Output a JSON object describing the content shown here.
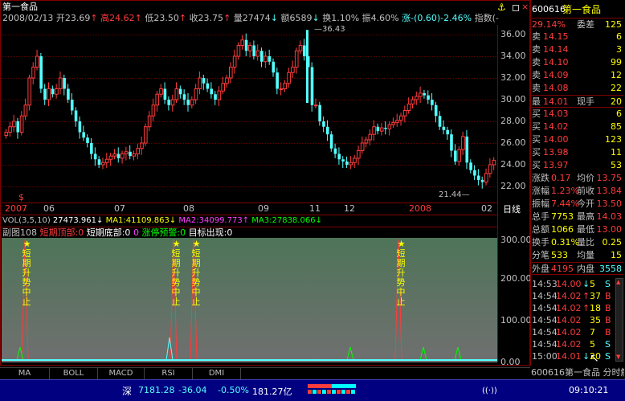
{
  "main_chart": {
    "title": "第一食品",
    "info": {
      "date": "2008/02/13",
      "open": "开23.69",
      "high": "高24.62",
      "low": "低23.50",
      "close": "收23.75",
      "volume": "量27474",
      "amount": "额6589",
      "turnover": "换1.10%",
      "amplitude": "振4.60%",
      "change": "涨-(0.60)-2.46%",
      "index_label": "指数(-"
    },
    "y_ticks": [
      "36.00",
      "34.00",
      "32.00",
      "30.00",
      "28.00",
      "26.00",
      "24.00",
      "22.00"
    ],
    "x_ticks": [
      "2007",
      "06",
      "07",
      "08",
      "09",
      "11",
      "12",
      "2008",
      "02"
    ],
    "period_label": "日线",
    "max_annotation": "36.43",
    "min_annotation": "21.44",
    "marker": "$",
    "colors": {
      "up": "#ff3c3c",
      "down": "#54ffff",
      "text_white": "#ffffff",
      "yellow": "#ffff00"
    }
  },
  "volume_bar": {
    "label": "VOL(3,5,10)",
    "value": "27473.961",
    "ma1": "MA1:41109.863",
    "ma2": "MA2:34099.773",
    "ma3": "MA3:27838.066"
  },
  "sub_chart": {
    "title": "副图108",
    "legend": [
      {
        "label": "短期顶部:0",
        "color": "#ff3c3c"
      },
      {
        "label": "短期底部:0",
        "color": "#ffffff"
      },
      {
        "label": "0",
        "color": "#ff40ff"
      },
      {
        "label": "涨停预警:0",
        "color": "#00ff00"
      },
      {
        "label": "目标出现:0",
        "color": "#ffffff"
      }
    ],
    "y_ticks": [
      "300.00",
      "200.00",
      "100.00",
      "0.00"
    ],
    "signal_text": "短期升势中止",
    "signal_star": "★"
  },
  "tabs": [
    "MA",
    "BOLL",
    "MACD",
    "RSI",
    "DMI"
  ],
  "quote_panel": {
    "code": "600616",
    "name": "第一食品",
    "ratio_label": "委差",
    "ratio_value": "125",
    "ratio_pct": "29.14%",
    "sells": [
      {
        "label": "卖",
        "price": "14.15",
        "vol": "6"
      },
      {
        "label": "卖",
        "price": "14.14",
        "vol": "3"
      },
      {
        "label": "卖",
        "price": "14.10",
        "vol": "99"
      },
      {
        "label": "卖",
        "price": "14.09",
        "vol": "12"
      },
      {
        "label": "卖",
        "price": "14.08",
        "vol": "22"
      }
    ],
    "last_label": "最",
    "last_price": "14.01",
    "last_hand_label": "现手",
    "last_hand": "20",
    "buys": [
      {
        "label": "买",
        "price": "14.03",
        "vol": "6"
      },
      {
        "label": "买",
        "price": "14.02",
        "vol": "85"
      },
      {
        "label": "买",
        "price": "14.00",
        "vol": "123"
      },
      {
        "label": "买",
        "price": "13.98",
        "vol": "11"
      },
      {
        "label": "买",
        "price": "13.97",
        "vol": "53"
      }
    ],
    "stats": [
      {
        "l1": "涨跌",
        "v1": "0.17",
        "l2": "均价",
        "v2": "13.75"
      },
      {
        "l1": "涨幅",
        "v1": "1.23%",
        "l2": "前收",
        "v2": "13.84"
      },
      {
        "l1": "振幅",
        "v1": "7.44%",
        "l2": "今开",
        "v2": "13.50"
      },
      {
        "l1": "总手",
        "v1": "7753",
        "l2": "最高",
        "v2": "14.03"
      },
      {
        "l1": "总额",
        "v1": "1066",
        "l2": "最低",
        "v2": "13.00"
      },
      {
        "l1": "换手",
        "v1": "0.31%",
        "l2": "量比",
        "v2": "0.25"
      },
      {
        "l1": "分笔",
        "v1": "533",
        "l2": "均量",
        "v2": "15"
      }
    ],
    "outer_label": "外盘",
    "outer_value": "4195",
    "inner_label": "内盘",
    "inner_value": "3558",
    "trades": [
      {
        "time": "14:53",
        "price": "14.00",
        "arrow": "↓",
        "vol": "5",
        "side": "S"
      },
      {
        "time": "14:54",
        "price": "14.02",
        "arrow": "↑",
        "vol": "37",
        "side": "B"
      },
      {
        "time": "14:54",
        "price": "14.02",
        "arrow": "↑",
        "vol": "18",
        "side": "B"
      },
      {
        "time": "14:54",
        "price": "14.02",
        "arrow": "",
        "vol": "35",
        "side": "B"
      },
      {
        "time": "14:54",
        "price": "14.02",
        "arrow": "",
        "vol": "7",
        "side": "B"
      },
      {
        "time": "14:54",
        "price": "14.02",
        "arrow": "",
        "vol": "5",
        "side": "S"
      },
      {
        "time": "15:00",
        "price": "14.01",
        "arrow": "↓",
        "vol": "20",
        "side": "S"
      }
    ],
    "footer": "600616第一食品 分时解"
  },
  "status_bar": {
    "market": "深",
    "index": "7181.28",
    "change": "-36.04",
    "pct": "-0.50%",
    "amount": "181.27亿",
    "time": "09:10:21"
  }
}
